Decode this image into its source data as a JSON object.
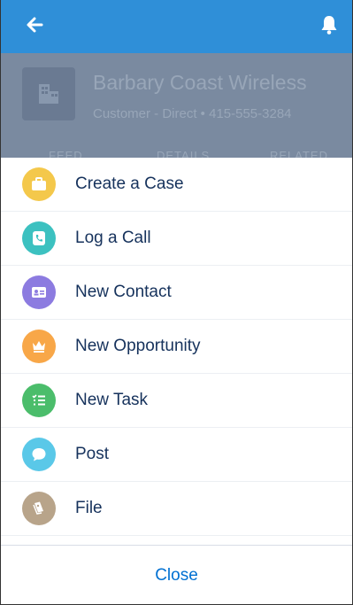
{
  "header": {
    "bg_color": "#2f8fd8",
    "back_icon": "arrow-left-icon",
    "notification_icon": "bell-icon"
  },
  "record": {
    "name": "Barbary Coast Wireless",
    "subtitle": "Customer - Direct  •  415-555-3284",
    "tabs": [
      "FEED",
      "DETAILS",
      "RELATED"
    ]
  },
  "actions": [
    {
      "label": "Create a Case",
      "icon": "briefcase-icon",
      "color": "#f4c84b"
    },
    {
      "label": "Log a Call",
      "icon": "phone-icon",
      "color": "#3cc1c0"
    },
    {
      "label": "New Contact",
      "icon": "contact-card-icon",
      "color": "#8c7be0"
    },
    {
      "label": "New Opportunity",
      "icon": "crown-icon",
      "color": "#f8a748"
    },
    {
      "label": "New Task",
      "icon": "task-list-icon",
      "color": "#4bbd6b"
    },
    {
      "label": "Post",
      "icon": "chat-bubble-icon",
      "color": "#5ac8e8"
    },
    {
      "label": "File",
      "icon": "file-icon",
      "color": "#b8a48a"
    }
  ],
  "close_label": "Close"
}
